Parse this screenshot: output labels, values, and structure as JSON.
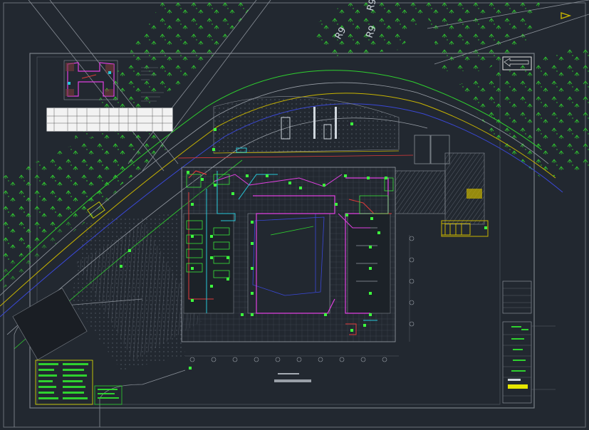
{
  "drawing": {
    "road_labels": [
      "R9",
      "R9",
      "R9"
    ],
    "north_arrow": "north-arrow",
    "colors": {
      "background": "#222830",
      "road": "#9aa0a8",
      "greenbelt": "#2fd12f",
      "centerline": "#c8b400",
      "blue_line": "#3a48d8",
      "magenta": "#e040e0",
      "cyan": "#27c7d8",
      "red": "#e03a3a",
      "node": "#3dff3d"
    }
  }
}
